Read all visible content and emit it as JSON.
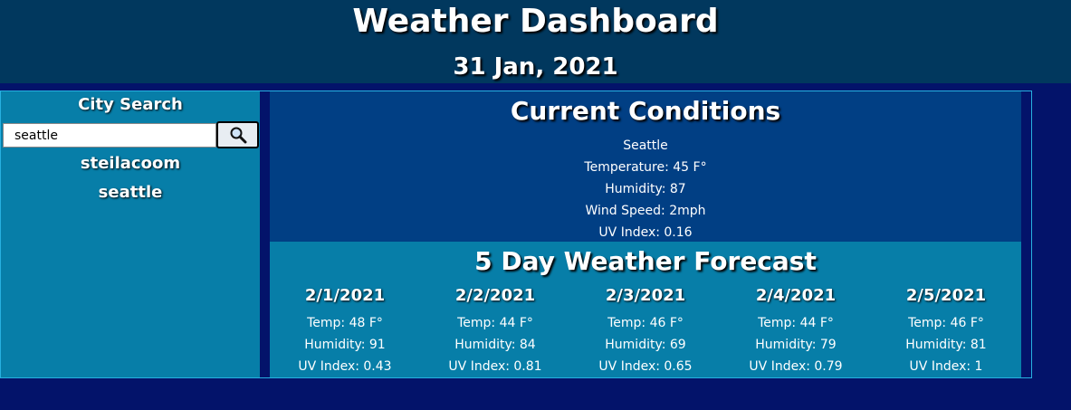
{
  "header": {
    "title": "Weather Dashboard",
    "date": "31 Jan, 2021"
  },
  "sidebar": {
    "title": "City Search",
    "search_value": "seattle",
    "search_icon": "magnifier-icon",
    "history": [
      "steilacoom",
      "seattle"
    ]
  },
  "current": {
    "title": "Current Conditions",
    "city": "Seattle",
    "temperature": "Temperature: 45 F°",
    "humidity": "Humidity: 87",
    "wind": "Wind Speed: 2mph",
    "uv": "UV Index: 0.16"
  },
  "forecast": {
    "title": "5 Day Weather Forecast",
    "days": [
      {
        "date": "2/1/2021",
        "temp": "Temp: 48 F°",
        "humidity": "Humidity: 91",
        "uv": "UV Index: 0.43"
      },
      {
        "date": "2/2/2021",
        "temp": "Temp: 44 F°",
        "humidity": "Humidity: 84",
        "uv": "UV Index: 0.81"
      },
      {
        "date": "2/3/2021",
        "temp": "Temp: 46 F°",
        "humidity": "Humidity: 69",
        "uv": "UV Index: 0.65"
      },
      {
        "date": "2/4/2021",
        "temp": "Temp: 44 F°",
        "humidity": "Humidity: 79",
        "uv": "UV Index: 0.79"
      },
      {
        "date": "2/5/2021",
        "temp": "Temp: 46 F°",
        "humidity": "Humidity: 81",
        "uv": "UV Index: 1"
      }
    ]
  },
  "colors": {
    "page_background": "#03136a",
    "header_background": "#01385e",
    "panel_teal": "#077ea8",
    "current_background": "#013f84",
    "border_accent": "#27b0e0"
  }
}
